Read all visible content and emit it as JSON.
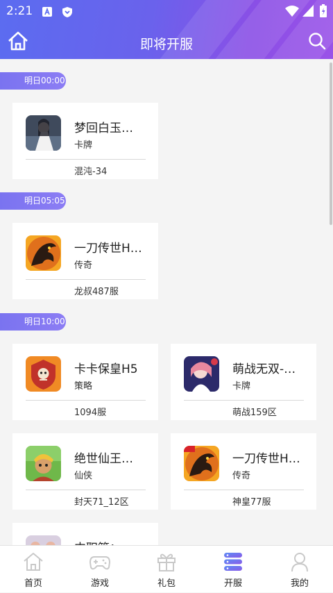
{
  "status_bar": {
    "time": "2:21"
  },
  "header": {
    "title": "即将开服"
  },
  "sections": [
    {
      "time": "明日00:00"
    },
    {
      "time": "明日05:05"
    },
    {
      "time": "明日10:00"
    }
  ],
  "cards": [
    {
      "name": "梦回白玉…",
      "category": "卡牌",
      "server": "混沌-34",
      "icon": "game-icon-mhby"
    },
    {
      "name": "一刀传世H…",
      "category": "传奇",
      "server": "龙叔487服",
      "icon": "game-icon-ydcs"
    },
    {
      "name": "卡卡保皇H5",
      "category": "策略",
      "server": "1094服",
      "icon": "game-icon-kkbh"
    },
    {
      "name": "萌战无双-…",
      "category": "卡牌",
      "server": "萌战159区",
      "icon": "game-icon-mzws"
    },
    {
      "name": "绝世仙王…",
      "category": "仙侠",
      "server": "封天71_12区",
      "icon": "game-icon-jsxw"
    },
    {
      "name": "一刀传世H…",
      "category": "传奇",
      "server": "神皇77服",
      "icon": "game-icon-ydcs"
    },
    {
      "name": "中职篮：…",
      "category": "",
      "server": "",
      "icon": "game-icon-zzl"
    }
  ],
  "tabs": [
    {
      "label": "首页",
      "icon": "home-icon"
    },
    {
      "label": "游戏",
      "icon": "gamepad-icon"
    },
    {
      "label": "礼包",
      "icon": "gift-icon"
    },
    {
      "label": "开服",
      "icon": "server-icon",
      "active": true
    },
    {
      "label": "我的",
      "icon": "user-icon"
    }
  ],
  "colors": {
    "header_start": "#5b6cf0",
    "header_end": "#9a52e8",
    "accent": "#7a73f0"
  }
}
